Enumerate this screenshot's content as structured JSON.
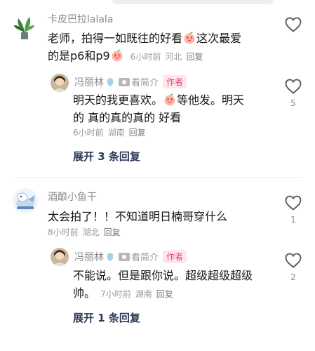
{
  "comments": [
    {
      "username": "卡皮巴拉lalala",
      "text_line1a": "老师，拍得一如既往的好看",
      "text_line1b": "这次最爱",
      "text_line2": "的是p6和p9",
      "time": "6小时前",
      "location": "河北",
      "reply_label": "回复",
      "likes": "",
      "reply": {
        "username": "冯丽林",
        "profile_label": "看简介",
        "author_badge": "作者",
        "text_line1a": "明天的我更喜欢。",
        "text_line1b": "等他发。明天",
        "text_line2": "的 真的真的真的 好看",
        "time": "6小时前",
        "location": "湖南",
        "reply_label": "回复",
        "likes": "5"
      },
      "expand_label": "展开 3 条回复"
    },
    {
      "username": "酒酿小鱼干",
      "text_line1": "太会拍了！！不知道明日楠哥穿什么",
      "time": "8小时前",
      "location": "湖北",
      "reply_label": "回复",
      "likes": "1",
      "reply": {
        "username": "冯丽林",
        "profile_label": "看简介",
        "author_badge": "作者",
        "text_line1": "不能说。但是跟你说。超级超级超级",
        "text_line2": "帅。",
        "time": "7小时前",
        "location": "湖南",
        "reply_label": "回复",
        "likes": "2"
      },
      "expand_label": "展开 1 条回复"
    }
  ],
  "icons": {
    "like": "heart-outline-icon",
    "profile": "camera-icon",
    "verified": "verified-badge-icon",
    "emoji": "peach-emoji-icon"
  },
  "colors": {
    "author_badge_text": "#e8426a",
    "author_badge_bg": "#fde7ec",
    "expand_text": "#2b3a55"
  }
}
